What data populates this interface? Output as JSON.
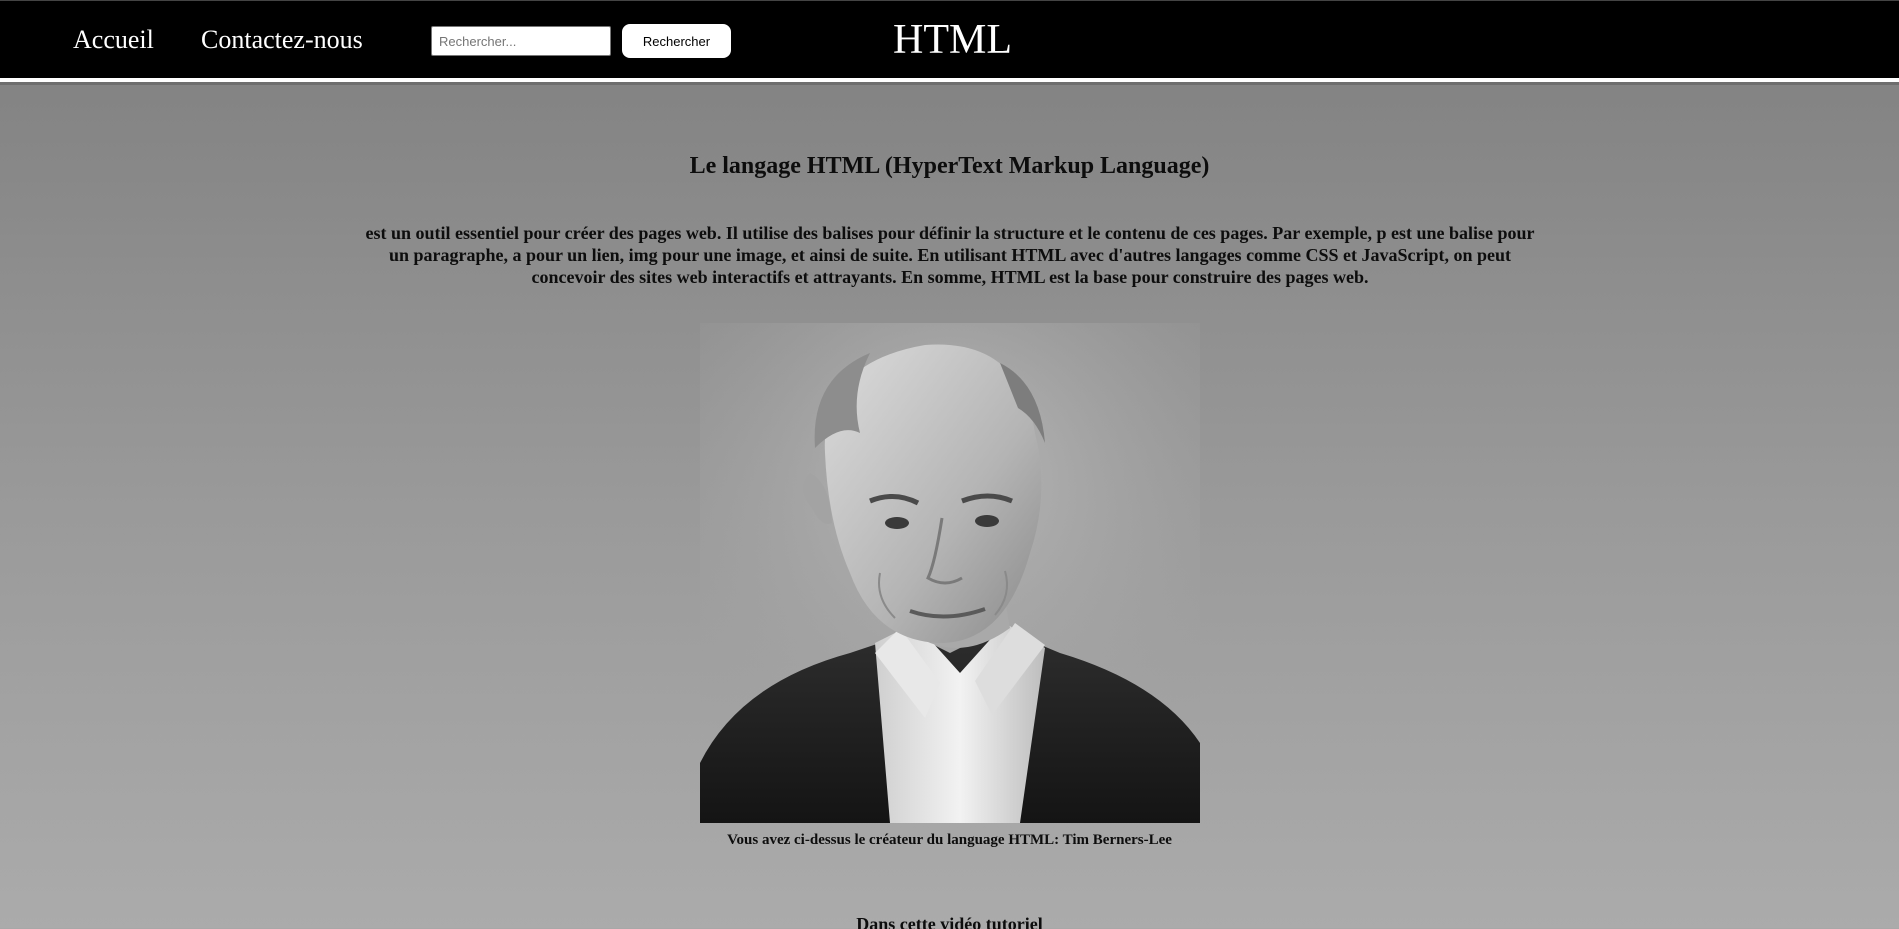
{
  "nav": {
    "home_label": "Accueil",
    "contact_label": "Contactez-nous",
    "search_placeholder": "Rechercher...",
    "search_value": "",
    "search_button_label": "Rechercher",
    "brand_title": "HTML"
  },
  "main": {
    "heading": "Le langage HTML (HyperText Markup Language)",
    "intro": "est un outil essentiel pour créer des pages web. Il utilise des balises pour définir la structure et le contenu de ces pages. Par exemple, p est une balise pour un paragraphe, a pour un lien, img pour une image, et ainsi de suite. En utilisant HTML avec d'autres langages comme CSS et JavaScript, on peut concevoir des sites web interactifs et attrayants. En somme, HTML est la base pour construire des pages web.",
    "caption": "Vous avez ci-dessus le créateur du language HTML: Tim Berners-Lee",
    "video_heading": "Dans cette vidéo tutoriel"
  },
  "colors": {
    "header_background": "#000000",
    "header_text": "#ffffff",
    "page_gradient_top": "#7f7f7f",
    "page_gradient_bottom": "#ababab",
    "body_text": "#0d0d0d"
  }
}
